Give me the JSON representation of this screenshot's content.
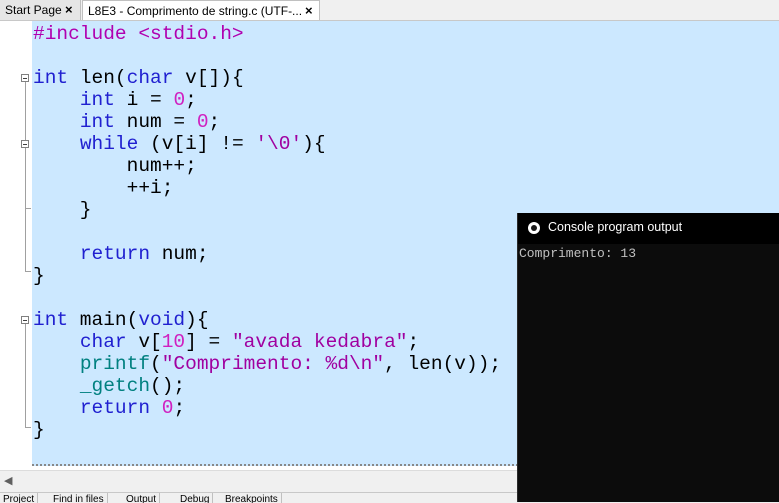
{
  "tabs": [
    {
      "label": "Start Page",
      "close": "×"
    },
    {
      "label": "L8E3 - Comprimento de string.c (UTF-...",
      "close": "×"
    }
  ],
  "code": [
    [
      {
        "t": "#include <stdio.h>",
        "c": "pp"
      }
    ],
    [],
    [
      {
        "t": "int",
        "c": "kw"
      },
      {
        "t": " len",
        "c": ""
      },
      {
        "t": "(",
        "c": ""
      },
      {
        "t": "char",
        "c": "kw"
      },
      {
        "t": " v[]){",
        "c": ""
      }
    ],
    [
      {
        "t": "    ",
        "c": ""
      },
      {
        "t": "int",
        "c": "kw"
      },
      {
        "t": " i = ",
        "c": ""
      },
      {
        "t": "0",
        "c": "num"
      },
      {
        "t": ";",
        "c": ""
      }
    ],
    [
      {
        "t": "    ",
        "c": ""
      },
      {
        "t": "int",
        "c": "kw"
      },
      {
        "t": " num = ",
        "c": ""
      },
      {
        "t": "0",
        "c": "num"
      },
      {
        "t": ";",
        "c": ""
      }
    ],
    [
      {
        "t": "    ",
        "c": ""
      },
      {
        "t": "while",
        "c": "kw"
      },
      {
        "t": " (v[i] != ",
        "c": ""
      },
      {
        "t": "'\\0'",
        "c": "str"
      },
      {
        "t": "){",
        "c": ""
      }
    ],
    [
      {
        "t": "        num++;",
        "c": ""
      }
    ],
    [
      {
        "t": "        ++i;",
        "c": ""
      }
    ],
    [
      {
        "t": "    }",
        "c": ""
      }
    ],
    [],
    [
      {
        "t": "    ",
        "c": ""
      },
      {
        "t": "return",
        "c": "kw"
      },
      {
        "t": " num;",
        "c": ""
      }
    ],
    [
      {
        "t": "}",
        "c": ""
      }
    ],
    [],
    [
      {
        "t": "int",
        "c": "kw"
      },
      {
        "t": " main(",
        "c": ""
      },
      {
        "t": "void",
        "c": "kw"
      },
      {
        "t": "){",
        "c": ""
      }
    ],
    [
      {
        "t": "    ",
        "c": ""
      },
      {
        "t": "char",
        "c": "kw"
      },
      {
        "t": " v[",
        "c": ""
      },
      {
        "t": "10",
        "c": "num"
      },
      {
        "t": "] = ",
        "c": ""
      },
      {
        "t": "\"avada kedabra\"",
        "c": "str"
      },
      {
        "t": ";",
        "c": ""
      }
    ],
    [
      {
        "t": "    ",
        "c": ""
      },
      {
        "t": "printf",
        "c": "fn"
      },
      {
        "t": "(",
        "c": ""
      },
      {
        "t": "\"Comprimento: %d\\n\"",
        "c": "str"
      },
      {
        "t": ", len(v));",
        "c": ""
      }
    ],
    [
      {
        "t": "    ",
        "c": ""
      },
      {
        "t": "_getch",
        "c": "fn"
      },
      {
        "t": "();",
        "c": ""
      }
    ],
    [
      {
        "t": "    ",
        "c": ""
      },
      {
        "t": "return",
        "c": "kw"
      },
      {
        "t": " ",
        "c": ""
      },
      {
        "t": "0",
        "c": "num"
      },
      {
        "t": ";",
        "c": ""
      }
    ],
    [
      {
        "t": "}",
        "c": ""
      }
    ]
  ],
  "bottom_tabs": [
    "Project",
    "Find in files",
    "Output",
    "Debug",
    "Breakpoints"
  ],
  "console": {
    "title": "Console program output",
    "output": "Comprimento: 13",
    "icon": "console-app-icon"
  },
  "colors": {
    "selection": "#cce8ff",
    "keyword": "#2020d0",
    "number": "#d020c0",
    "string": "#a000a0",
    "function": "#008080",
    "console_bg": "#0c0c0c"
  }
}
